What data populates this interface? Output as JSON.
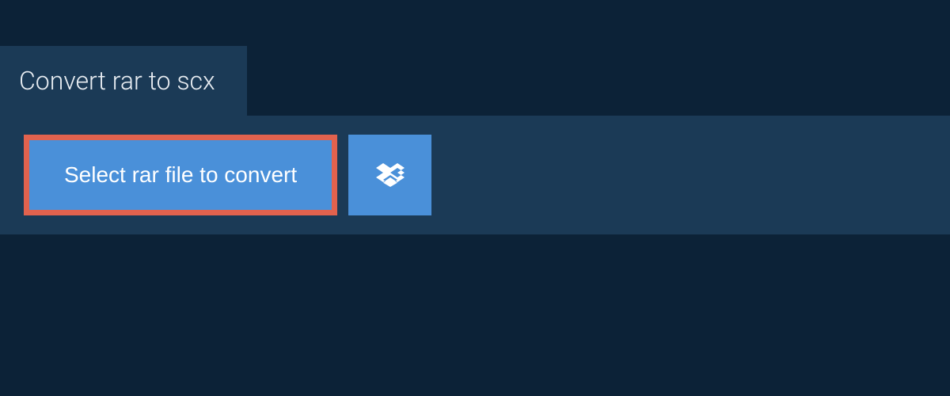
{
  "tab": {
    "title": "Convert rar to scx"
  },
  "actions": {
    "select_file_label": "Select rar file to convert"
  },
  "colors": {
    "background": "#0c2237",
    "panel": "#1b3a56",
    "button": "#4a90d9",
    "button_border": "#e2624e",
    "text_light": "#e8edf2"
  }
}
